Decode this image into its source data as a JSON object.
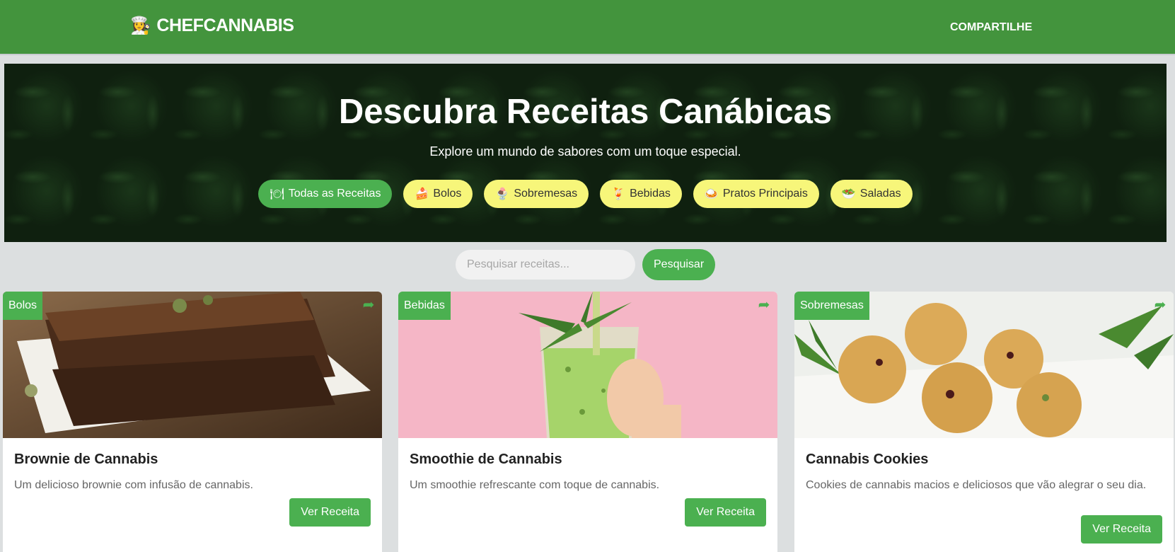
{
  "nav": {
    "brand_icon": "chef-icon",
    "brand_icon_glyph": "👩‍🍳",
    "brand": "CHEFCANNABIS",
    "share": "COMPARTILHE",
    "bg_color": "#43943d"
  },
  "hero": {
    "title": "Descubra Receitas Canábicas",
    "subtitle": "Explore um mundo de sabores com um toque especial."
  },
  "categories": [
    {
      "icon": "plate-icon",
      "glyph": "🍽",
      "label": "Todas as Receitas",
      "active": true
    },
    {
      "icon": "cake-icon",
      "glyph": "🍰",
      "label": "Bolos",
      "active": false
    },
    {
      "icon": "dessert-icon",
      "glyph": "🍨",
      "label": "Sobremesas",
      "active": false
    },
    {
      "icon": "drink-icon",
      "glyph": "🍹",
      "label": "Bebidas",
      "active": false
    },
    {
      "icon": "dish-icon",
      "glyph": "🍛",
      "label": "Pratos Principais",
      "active": false
    },
    {
      "icon": "salad-icon",
      "glyph": "🥗",
      "label": "Saladas",
      "active": false
    }
  ],
  "search": {
    "placeholder": "Pesquisar receitas...",
    "button": "Pesquisar"
  },
  "cards": [
    {
      "tag": "Bolos",
      "title": "Brownie de Cannabis",
      "description": "Um delicioso brownie com infusão de cannabis.",
      "button": "Ver Receita",
      "image": "brownie-photo"
    },
    {
      "tag": "Bebidas",
      "title": "Smoothie de Cannabis",
      "description": "Um smoothie refrescante com toque de cannabis.",
      "button": "Ver Receita",
      "image": "green-smoothie-photo"
    },
    {
      "tag": "Sobremesas",
      "title": "Cannabis Cookies",
      "description": "Cookies de cannabis macios e deliciosos que vão alegrar o seu dia.",
      "button": "Ver Receita",
      "image": "cookies-photo"
    }
  ],
  "colors": {
    "accent": "#4bb050",
    "pill": "#f7f67a",
    "hero_bg": "#0f200f"
  }
}
